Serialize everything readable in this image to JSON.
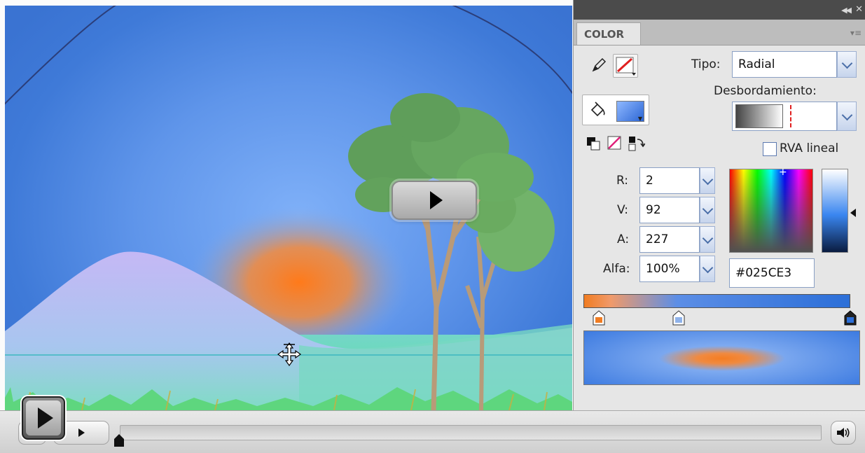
{
  "panel": {
    "tab_label": "COLOR",
    "tipo_label": "Tipo:",
    "tipo_value": "Radial",
    "overflow_label": "Desbordamiento:",
    "linear_rgb_label": "RVA lineal",
    "linear_rgb_checked": false,
    "channels": [
      {
        "label": "R:",
        "value": "2"
      },
      {
        "label": "V:",
        "value": "92"
      },
      {
        "label": "A:",
        "value": "227"
      },
      {
        "label": "Alfa:",
        "value": "100%"
      }
    ],
    "hex_value": "#025CE3",
    "gradient_colors": {
      "start": "#f07c22",
      "end": "#2c6fd8"
    },
    "selected_color": "#025CE3"
  },
  "icons": {
    "stroke": "pencil-icon",
    "fill": "paint-bucket-icon",
    "black_white": "black-white-swatch-icon",
    "no_color": "no-color-icon",
    "swap": "swap-colors-icon",
    "move": "move-cursor-icon",
    "volume": "speaker-icon"
  },
  "player": {
    "progress": 0.0
  }
}
